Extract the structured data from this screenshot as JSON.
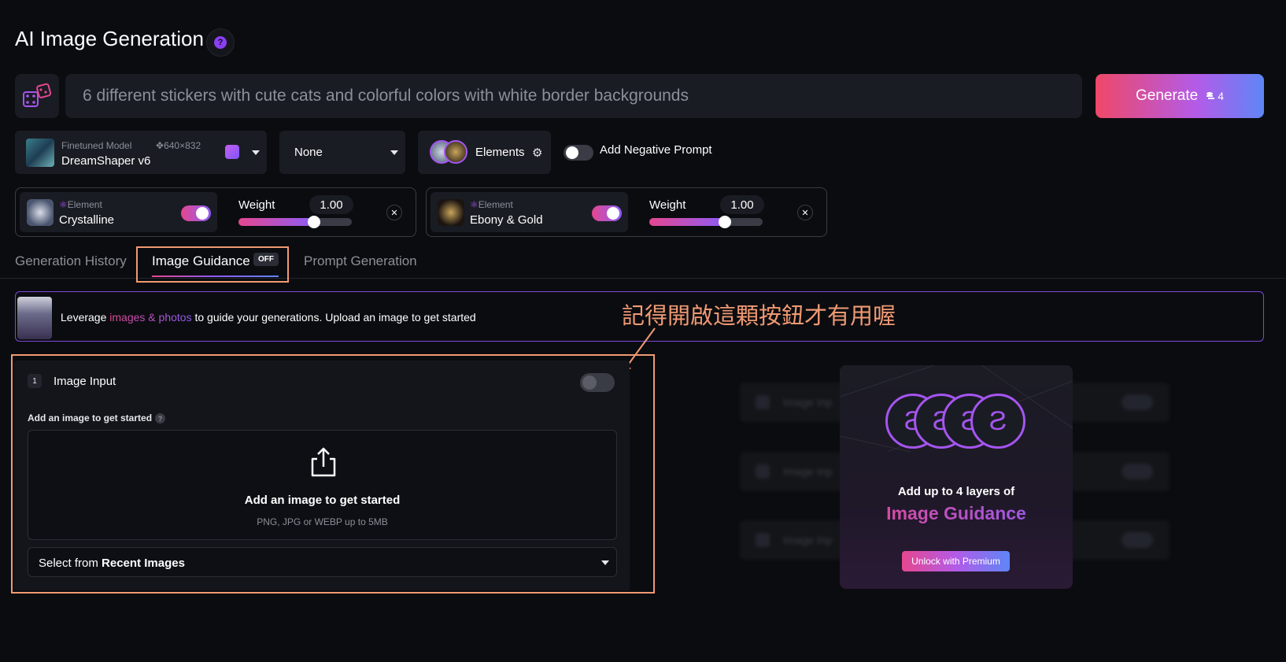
{
  "page": {
    "title": "AI Image Generation",
    "help_icon": "question-circle-icon"
  },
  "prompt": {
    "value": "6 different stickers with cute cats and  colorful colors with white border backgrounds",
    "random_icon": "dice-icon"
  },
  "generate": {
    "label": "Generate",
    "token_cost": "4",
    "token_icon": "coins-icon"
  },
  "model": {
    "caption": "Finetuned Model",
    "dimensions": "640×832",
    "name": "DreamShaper v6"
  },
  "preset": {
    "value": "None"
  },
  "elements_picker": {
    "label": "Elements",
    "icon": "gear-icon"
  },
  "negative_prompt": {
    "label": "Add Negative Prompt",
    "enabled": false
  },
  "elements": [
    {
      "caption": "Element",
      "name": "Crystalline",
      "weight_label": "Weight",
      "weight": "1.00",
      "enabled": true
    },
    {
      "caption": "Element",
      "name": "Ebony & Gold",
      "weight_label": "Weight",
      "weight": "1.00",
      "enabled": true
    }
  ],
  "tabs": {
    "history": "Generation History",
    "guidance": "Image Guidance",
    "guidance_badge": "OFF",
    "prompt_gen": "Prompt Generation"
  },
  "banner": {
    "pre": "Leverage ",
    "highlight": "images & photos",
    "post": " to guide your generations. Upload an image to get started"
  },
  "annotation": {
    "text": "記得開啟這顆按鈕才有用喔"
  },
  "image_input": {
    "number": "1",
    "title": "Image Input",
    "enabled": false,
    "add_label": "Add an image to get started",
    "drop_title": "Add an image to get started",
    "drop_sub": "PNG, JPG or WEBP up to 5MB",
    "select_pre": "Select from ",
    "select_bold": "Recent Images"
  },
  "locked_inputs": [
    {
      "number": "2",
      "label": "Image Inp"
    },
    {
      "number": "3",
      "label": "Image Inp"
    },
    {
      "number": "4",
      "label": "Image Inp"
    }
  ],
  "promo": {
    "line1": "Add up to 4 layers of",
    "line2": "Image Guidance",
    "button": "Unlock with Premium"
  },
  "colors": {
    "background": "#0b0c10",
    "panel": "#1a1c23",
    "accent_pink": "#e5478f",
    "accent_purple": "#8d5cf6",
    "annotation": "#f09a73"
  }
}
